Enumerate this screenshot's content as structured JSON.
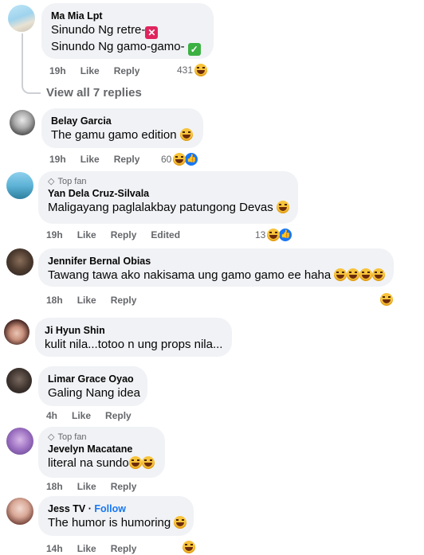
{
  "comments": [
    {
      "author": "Ma Mia Lpt",
      "lines": [
        "Sinundo Ng retre-",
        "Sinundo Ng gamo-gamo-"
      ],
      "time": "19h",
      "like": "Like",
      "reply": "Reply",
      "reactions": "431"
    },
    {
      "view_replies": "View all 7 replies"
    },
    {
      "author": "Belay Garcia",
      "text": "The gamu gamo edition",
      "time": "19h",
      "like": "Like",
      "reply": "Reply",
      "reactions": "60"
    },
    {
      "badge": "Top fan",
      "author": "Yan Dela Cruz-Silvala",
      "text": "Maligayang paglalakbay patungong Devas",
      "time": "19h",
      "like": "Like",
      "reply": "Reply",
      "edited": "Edited",
      "reactions": "13"
    },
    {
      "author": "Jennifer Bernal Obias",
      "text": "Tawang tawa ako nakisama ung gamo gamo ee haha",
      "time": "18h",
      "like": "Like",
      "reply": "Reply"
    },
    {
      "author": "Ji Hyun Shin",
      "text": "kulit nila...totoo n ung props nila..."
    },
    {
      "author": "Limar Grace Oyao",
      "text": "Galing Nang idea",
      "time": "4h",
      "like": "Like",
      "reply": "Reply"
    },
    {
      "badge": "Top fan",
      "author": "Jevelyn Macatane",
      "text": "literal na sundo",
      "time": "18h",
      "like": "Like",
      "reply": "Reply"
    },
    {
      "author": "Jess TV",
      "follow": "Follow",
      "text": "The humor is humoring",
      "time": "14h",
      "like": "Like",
      "reply": "Reply"
    }
  ],
  "colors": {
    "bubble": "#f0f2f5",
    "meta": "#65676b",
    "link": "#1877f2",
    "emoji": "#f7c33b"
  },
  "icons": [
    "laughing-emoji-icon",
    "like-reaction-icon",
    "red-x-icon",
    "green-check-icon",
    "top-fan-diamond-icon",
    "rofl-emoji-icon"
  ]
}
